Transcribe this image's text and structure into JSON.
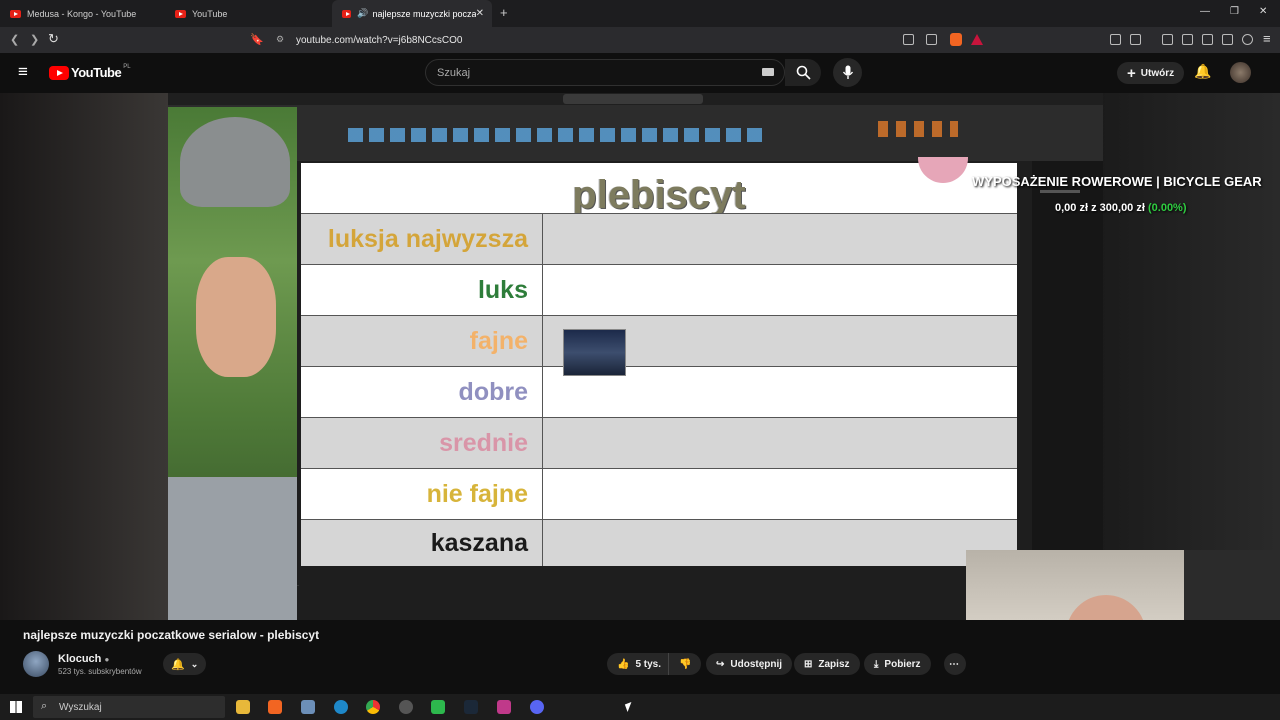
{
  "browser": {
    "tabs": [
      {
        "label": "Medusa - Kongo - YouTube"
      },
      {
        "label": "YouTube"
      },
      {
        "label": "najlepsze muzyczki poczatkow"
      }
    ],
    "url": "youtube.com/watch?v=j6b8NCcsCO0"
  },
  "youtube": {
    "logo": "YouTube",
    "region": "PL",
    "search_placeholder": "Szukaj",
    "create_label": "Utwórz"
  },
  "slide": {
    "title": "plebiscyt",
    "rows": [
      {
        "label": "luksja najwyzsza",
        "color": "#d4a53a"
      },
      {
        "label": "luks",
        "color": "#2e7d3a"
      },
      {
        "label": "fajne",
        "color": "#f3b26a"
      },
      {
        "label": "dobre",
        "color": "#9090c0"
      },
      {
        "label": "srednie",
        "color": "#d995a8"
      },
      {
        "label": "nie fajne",
        "color": "#d7b43a"
      },
      {
        "label": "kaszana",
        "color": "#1a1a1a"
      }
    ]
  },
  "overlay": {
    "title": "WYPOSAŻENIE ROWEROWE | BICYCLE GEAR",
    "amount": "0,00 zł",
    "separator": "z",
    "goal": "300,00 zł",
    "percent": "(0.00%)"
  },
  "video": {
    "title": "najlepsze muzyczki poczatkowe serialow - plebiscyt",
    "channel": "Klocuch",
    "subscribers": "523 tys. subskrybentów",
    "likes": "5 tys.",
    "share_label": "Udostępnij",
    "save_label": "Zapisz",
    "download_label": "Pobierz"
  },
  "taskbar": {
    "search_label": "Wyszukaj"
  },
  "colors": {
    "youtube_red": "#ff0000",
    "accent_green": "#2ecc40"
  }
}
